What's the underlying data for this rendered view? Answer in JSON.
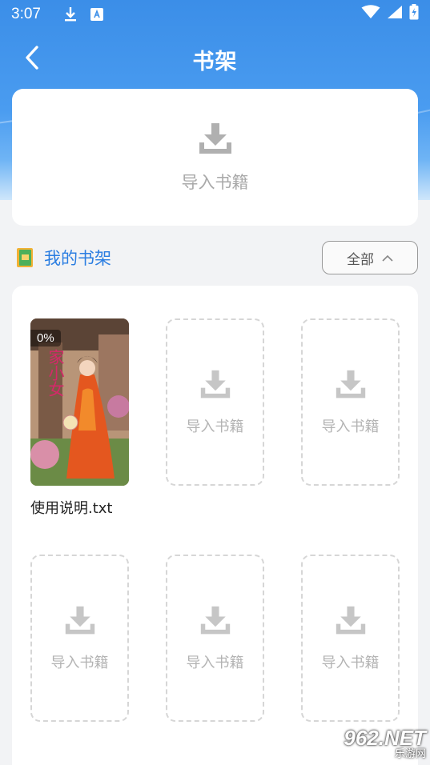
{
  "status_bar": {
    "time": "3:07"
  },
  "app_bar": {
    "title": "书架"
  },
  "import_card": {
    "label": "导入书籍"
  },
  "shelf_section": {
    "title": "我的书架",
    "filter_label": "全部"
  },
  "books": [
    {
      "name": "使用说明.txt",
      "progress": "0%",
      "cover_title": "家小女"
    }
  ],
  "empty_slot_label": "导入书籍",
  "watermark": {
    "line1": "962.NET",
    "line2": "乐游网"
  },
  "colors": {
    "header_blue": "#3b8ee8",
    "accent_blue": "#2a7de1",
    "placeholder_gray": "#b3b3b3",
    "background": "#f2f3f5"
  }
}
